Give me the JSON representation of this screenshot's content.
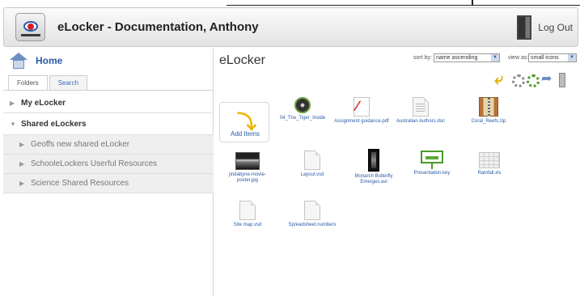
{
  "header": {
    "title": "eLocker - Documentation, Anthony",
    "logout_label": "Log Out"
  },
  "sidebar": {
    "home_label": "Home",
    "tabs": [
      {
        "label": "Folders",
        "active": true
      },
      {
        "label": "Search",
        "active": false
      }
    ],
    "tree": [
      {
        "label": "My eLocker",
        "expanded": false
      },
      {
        "label": "Shared eLockers",
        "expanded": true
      },
      {
        "label": "Geoffs new shared eLocker"
      },
      {
        "label": "SchooleLockers Userful Resources"
      },
      {
        "label": "Science Shared Resources"
      }
    ]
  },
  "main": {
    "title": "eLocker",
    "sort_label": "sort by:",
    "sort_value": "name ascending",
    "view_label": "view as:",
    "view_value": "small icons",
    "add_items_label": "Add Items",
    "files": [
      {
        "name": "04_The_Tiger_Inside",
        "icon": "disc-icon"
      },
      {
        "name": "Assignment guidance.pdf",
        "icon": "pdf-icon"
      },
      {
        "name": "Australian Authors.doc",
        "icon": "document-icon"
      },
      {
        "name": "Coral_Reefs.zip",
        "icon": "zip-icon"
      },
      {
        "name": "jindabyne-movie-poster.jpg",
        "icon": "image-icon"
      },
      {
        "name": "Layout.vsd",
        "icon": "document-icon"
      },
      {
        "name": "Monarch Butterfly Emerges.avi",
        "icon": "video-icon"
      },
      {
        "name": "Presentation.key",
        "icon": "presentation-icon"
      },
      {
        "name": "Rainfall.xls",
        "icon": "spreadsheet-icon"
      },
      {
        "name": "Site map.vsd",
        "icon": "document-icon"
      },
      {
        "name": "Spreadsheet.numbers",
        "icon": "document-icon"
      }
    ]
  },
  "colors": {
    "link": "#2a5ba8",
    "accent_green": "#4a9a2a",
    "accent_yellow": "#f0b400"
  }
}
